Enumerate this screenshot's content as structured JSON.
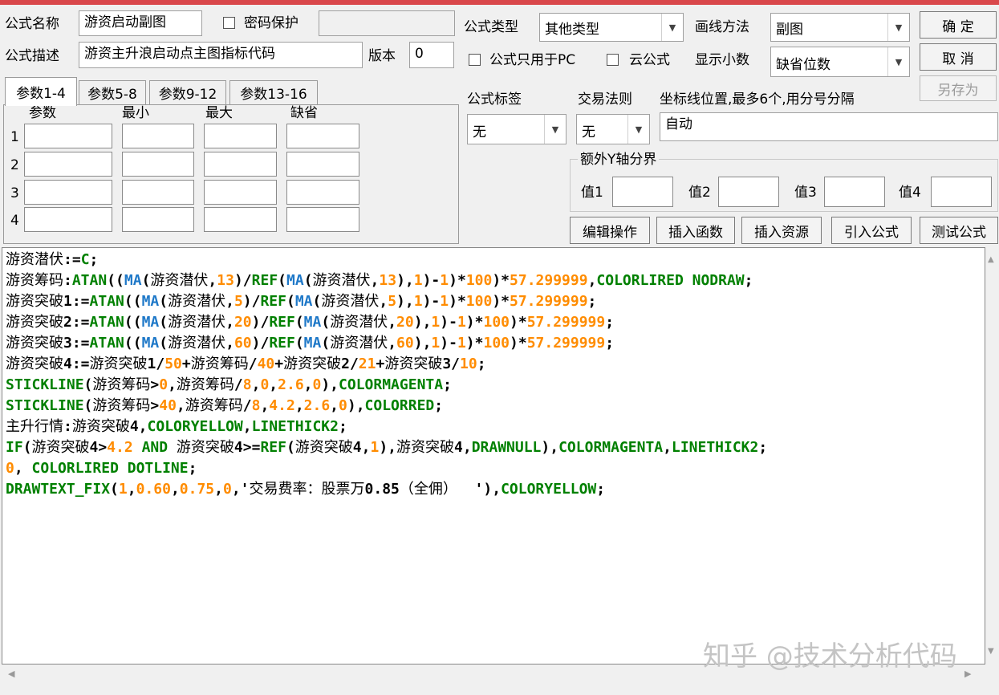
{
  "colors": {
    "topbar": "#d9474b",
    "keyword": "#008000",
    "ma": "#1e78c8",
    "number": "#ff8c00"
  },
  "form": {
    "name_label": "公式名称",
    "name_value": "游资启动副图",
    "password_label": "密码保护",
    "desc_label": "公式描述",
    "desc_value": "游资主升浪启动点主图指标代码",
    "version_label": "版本",
    "version_value": "0",
    "type_label": "公式类型",
    "type_value": "其他类型",
    "draw_label": "画线方法",
    "draw_value": "副图",
    "pc_only_label": "公式只用于PC",
    "cloud_label": "云公式",
    "decimals_label": "显示小数",
    "decimals_value": "缺省位数",
    "tag_label": "公式标签",
    "tag_value": "无",
    "rule_label": "交易法则",
    "rule_value": "无",
    "coord_label": "坐标线位置,最多6个,用分号分隔",
    "coord_value": "自动",
    "extra_y_label": "额外Y轴分界",
    "val1": "值1",
    "val2": "值2",
    "val3": "值3",
    "val4": "值4"
  },
  "buttons": {
    "ok": "确  定",
    "cancel": "取  消",
    "saveas": "另存为",
    "edit": "编辑操作",
    "insert_fn": "插入函数",
    "insert_res": "插入资源",
    "import": "引入公式",
    "test": "测试公式"
  },
  "params": {
    "tabs": [
      "参数1-4",
      "参数5-8",
      "参数9-12",
      "参数13-16"
    ],
    "headers": [
      "参数",
      "最小",
      "最大",
      "缺省"
    ],
    "rows": [
      "1",
      "2",
      "3",
      "4"
    ]
  },
  "code": [
    [
      [
        "cn",
        "游资潜伏"
      ],
      [
        "op",
        ":="
      ],
      [
        "fn",
        "C"
      ],
      [
        "op",
        ";"
      ]
    ],
    [
      [
        "cn",
        "游资筹码"
      ],
      [
        "op",
        ":"
      ],
      [
        "fn",
        "ATAN"
      ],
      [
        "op",
        "(("
      ],
      [
        "ma",
        "MA"
      ],
      [
        "op",
        "("
      ],
      [
        "cn",
        "游资潜伏"
      ],
      [
        "op",
        ","
      ],
      [
        "num",
        "13"
      ],
      [
        "op",
        ")/"
      ],
      [
        "fn",
        "REF"
      ],
      [
        "op",
        "("
      ],
      [
        "ma",
        "MA"
      ],
      [
        "op",
        "("
      ],
      [
        "cn",
        "游资潜伏"
      ],
      [
        "op",
        ","
      ],
      [
        "num",
        "13"
      ],
      [
        "op",
        "),"
      ],
      [
        "num",
        "1"
      ],
      [
        "op",
        ")-"
      ],
      [
        "num",
        "1"
      ],
      [
        "op",
        ")*"
      ],
      [
        "num",
        "100"
      ],
      [
        "op",
        ")*"
      ],
      [
        "num",
        "57.299999"
      ],
      [
        "op",
        ","
      ],
      [
        "fn",
        "COLORLIRED NODRAW"
      ],
      [
        "op",
        ";"
      ]
    ],
    [
      [
        "cn",
        "游资突破"
      ],
      [
        "op",
        "1:="
      ],
      [
        "fn",
        "ATAN"
      ],
      [
        "op",
        "(("
      ],
      [
        "ma",
        "MA"
      ],
      [
        "op",
        "("
      ],
      [
        "cn",
        "游资潜伏"
      ],
      [
        "op",
        ","
      ],
      [
        "num",
        "5"
      ],
      [
        "op",
        ")/"
      ],
      [
        "fn",
        "REF"
      ],
      [
        "op",
        "("
      ],
      [
        "ma",
        "MA"
      ],
      [
        "op",
        "("
      ],
      [
        "cn",
        "游资潜伏"
      ],
      [
        "op",
        ","
      ],
      [
        "num",
        "5"
      ],
      [
        "op",
        "),"
      ],
      [
        "num",
        "1"
      ],
      [
        "op",
        ")-"
      ],
      [
        "num",
        "1"
      ],
      [
        "op",
        ")*"
      ],
      [
        "num",
        "100"
      ],
      [
        "op",
        ")*"
      ],
      [
        "num",
        "57.299999"
      ],
      [
        "op",
        ";"
      ]
    ],
    [
      [
        "cn",
        "游资突破"
      ],
      [
        "op",
        "2:="
      ],
      [
        "fn",
        "ATAN"
      ],
      [
        "op",
        "(("
      ],
      [
        "ma",
        "MA"
      ],
      [
        "op",
        "("
      ],
      [
        "cn",
        "游资潜伏"
      ],
      [
        "op",
        ","
      ],
      [
        "num",
        "20"
      ],
      [
        "op",
        ")/"
      ],
      [
        "fn",
        "REF"
      ],
      [
        "op",
        "("
      ],
      [
        "ma",
        "MA"
      ],
      [
        "op",
        "("
      ],
      [
        "cn",
        "游资潜伏"
      ],
      [
        "op",
        ","
      ],
      [
        "num",
        "20"
      ],
      [
        "op",
        "),"
      ],
      [
        "num",
        "1"
      ],
      [
        "op",
        ")-"
      ],
      [
        "num",
        "1"
      ],
      [
        "op",
        ")*"
      ],
      [
        "num",
        "100"
      ],
      [
        "op",
        ")*"
      ],
      [
        "num",
        "57.299999"
      ],
      [
        "op",
        ";"
      ]
    ],
    [
      [
        "cn",
        "游资突破"
      ],
      [
        "op",
        "3:="
      ],
      [
        "fn",
        "ATAN"
      ],
      [
        "op",
        "(("
      ],
      [
        "ma",
        "MA"
      ],
      [
        "op",
        "("
      ],
      [
        "cn",
        "游资潜伏"
      ],
      [
        "op",
        ","
      ],
      [
        "num",
        "60"
      ],
      [
        "op",
        ")/"
      ],
      [
        "fn",
        "REF"
      ],
      [
        "op",
        "("
      ],
      [
        "ma",
        "MA"
      ],
      [
        "op",
        "("
      ],
      [
        "cn",
        "游资潜伏"
      ],
      [
        "op",
        ","
      ],
      [
        "num",
        "60"
      ],
      [
        "op",
        "),"
      ],
      [
        "num",
        "1"
      ],
      [
        "op",
        ")-"
      ],
      [
        "num",
        "1"
      ],
      [
        "op",
        ")*"
      ],
      [
        "num",
        "100"
      ],
      [
        "op",
        ")*"
      ],
      [
        "num",
        "57.299999"
      ],
      [
        "op",
        ";"
      ]
    ],
    [
      [
        "cn",
        "游资突破"
      ],
      [
        "op",
        "4:="
      ],
      [
        "cn",
        "游资突破"
      ],
      [
        "op",
        "1/"
      ],
      [
        "num",
        "50"
      ],
      [
        "op",
        "+"
      ],
      [
        "cn",
        "游资筹码"
      ],
      [
        "op",
        "/"
      ],
      [
        "num",
        "40"
      ],
      [
        "op",
        "+"
      ],
      [
        "cn",
        "游资突破"
      ],
      [
        "op",
        "2/"
      ],
      [
        "num",
        "21"
      ],
      [
        "op",
        "+"
      ],
      [
        "cn",
        "游资突破"
      ],
      [
        "op",
        "3/"
      ],
      [
        "num",
        "10"
      ],
      [
        "op",
        ";"
      ]
    ],
    [
      [
        "fn",
        "STICKLINE"
      ],
      [
        "op",
        "("
      ],
      [
        "cn",
        "游资筹码"
      ],
      [
        "op",
        ">"
      ],
      [
        "num",
        "0"
      ],
      [
        "op",
        ","
      ],
      [
        "cn",
        "游资筹码"
      ],
      [
        "op",
        "/"
      ],
      [
        "num",
        "8"
      ],
      [
        "op",
        ","
      ],
      [
        "num",
        "0"
      ],
      [
        "op",
        ","
      ],
      [
        "num",
        "2.6"
      ],
      [
        "op",
        ","
      ],
      [
        "num",
        "0"
      ],
      [
        "op",
        "),"
      ],
      [
        "fn",
        "COLORMAGENTA"
      ],
      [
        "op",
        ";"
      ]
    ],
    [
      [
        "fn",
        "STICKLINE"
      ],
      [
        "op",
        "("
      ],
      [
        "cn",
        "游资筹码"
      ],
      [
        "op",
        ">"
      ],
      [
        "num",
        "40"
      ],
      [
        "op",
        ","
      ],
      [
        "cn",
        "游资筹码"
      ],
      [
        "op",
        "/"
      ],
      [
        "num",
        "8"
      ],
      [
        "op",
        ","
      ],
      [
        "num",
        "4.2"
      ],
      [
        "op",
        ","
      ],
      [
        "num",
        "2.6"
      ],
      [
        "op",
        ","
      ],
      [
        "num",
        "0"
      ],
      [
        "op",
        "),"
      ],
      [
        "fn",
        "COLORRED"
      ],
      [
        "op",
        ";"
      ]
    ],
    [
      [
        "cn",
        "主升行情"
      ],
      [
        "op",
        ":"
      ],
      [
        "cn",
        "游资突破"
      ],
      [
        "op",
        "4,"
      ],
      [
        "fn",
        "COLORYELLOW"
      ],
      [
        "op",
        ","
      ],
      [
        "fn",
        "LINETHICK2"
      ],
      [
        "op",
        ";"
      ]
    ],
    [
      [
        "fn",
        "IF"
      ],
      [
        "op",
        "("
      ],
      [
        "cn",
        "游资突破"
      ],
      [
        "op",
        "4>"
      ],
      [
        "num",
        "4.2"
      ],
      [
        "fn",
        " AND "
      ],
      [
        "cn",
        "游资突破"
      ],
      [
        "op",
        "4>="
      ],
      [
        "fn",
        "REF"
      ],
      [
        "op",
        "("
      ],
      [
        "cn",
        "游资突破"
      ],
      [
        "op",
        "4,"
      ],
      [
        "num",
        "1"
      ],
      [
        "op",
        "),"
      ],
      [
        "cn",
        "游资突破"
      ],
      [
        "op",
        "4,"
      ],
      [
        "fn",
        "DRAWNULL"
      ],
      [
        "op",
        "),"
      ],
      [
        "fn",
        "COLORMAGENTA"
      ],
      [
        "op",
        ","
      ],
      [
        "fn",
        "LINETHICK2"
      ],
      [
        "op",
        ";"
      ]
    ],
    [
      [
        "num",
        "0"
      ],
      [
        "op",
        ", "
      ],
      [
        "fn",
        "COLORLIRED DOTLINE"
      ],
      [
        "op",
        ";"
      ]
    ],
    [
      [
        "fn",
        "DRAWTEXT_FIX"
      ],
      [
        "op",
        "("
      ],
      [
        "num",
        "1"
      ],
      [
        "op",
        ","
      ],
      [
        "num",
        "0.60"
      ],
      [
        "op",
        ","
      ],
      [
        "num",
        "0.75"
      ],
      [
        "op",
        ","
      ],
      [
        "num",
        "0"
      ],
      [
        "op",
        ",'"
      ],
      [
        "cn",
        "交易费率：股票万"
      ],
      [
        "op",
        "0.85"
      ],
      [
        "cn",
        "（全佣）"
      ],
      [
        "op",
        "  '),"
      ],
      [
        "fn",
        "COLORYELLOW"
      ],
      [
        "op",
        ";"
      ]
    ]
  ],
  "watermark": "知乎 @技术分析代码"
}
